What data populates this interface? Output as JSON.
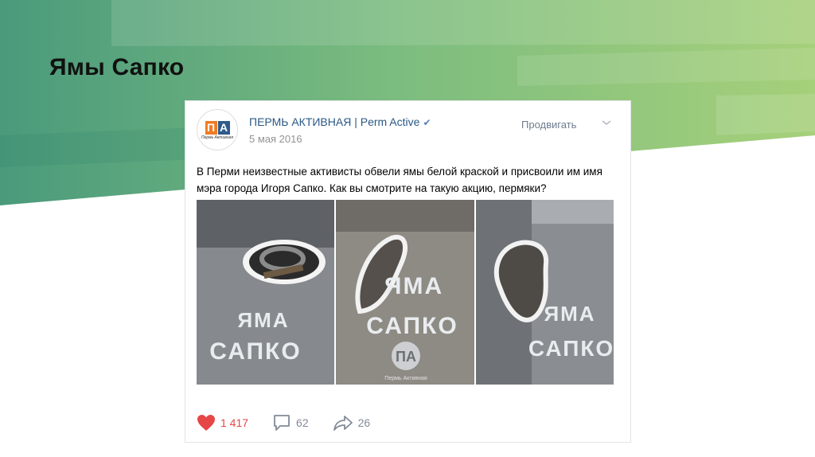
{
  "slide": {
    "title": "Ямы Сапко"
  },
  "post": {
    "author": "ПЕРМЬ АКТИВНАЯ | Perm Active",
    "verified_icon": "check-icon",
    "date": "5 мая 2016",
    "promote_label": "Продвигать",
    "text": "В Перми неизвестные активисты обвели ямы белой краской и присвоили им имя мэра города Игоря Сапко. Как вы смотрите на такую акцию, пермяки?",
    "avatar": {
      "logo_letters": "ПА",
      "logo_sub": "Пермь Активная"
    },
    "photos": [
      {
        "stencil_line1": "ЯМА",
        "stencil_line2": "САПКО"
      },
      {
        "stencil_line1": "ЯМА",
        "stencil_line2": "САПКО",
        "watermark": "ПА",
        "watermark_sub": "Пермь Активная"
      },
      {
        "stencil_line1": "ЯМА",
        "stencil_line2": "САПКО"
      }
    ],
    "actions": {
      "likes": "1 417",
      "comments": "62",
      "shares": "26"
    }
  },
  "colors": {
    "accent_green": "#5fae7f",
    "like_red": "#e64646",
    "link_blue": "#2a5885"
  }
}
